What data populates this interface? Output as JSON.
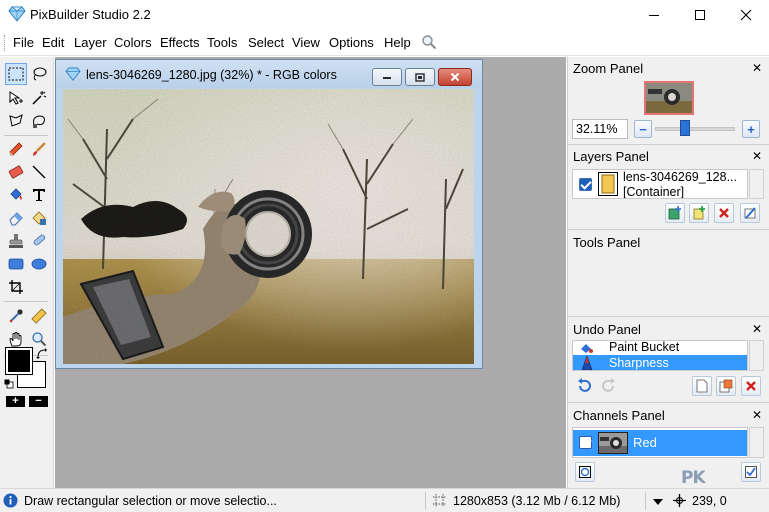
{
  "window": {
    "title": "PixBuilder Studio 2.2"
  },
  "menu": {
    "items": [
      "File",
      "Edit",
      "Layer",
      "Colors",
      "Effects",
      "Tools",
      "Select",
      "View",
      "Options",
      "Help"
    ]
  },
  "document": {
    "title": "lens-3046269_1280.jpg (32%) * - RGB colors"
  },
  "panels": {
    "zoom": {
      "title": "Zoom Panel",
      "value": "32.11%"
    },
    "layers": {
      "title": "Layers Panel",
      "item": {
        "name": "lens-3046269_128...",
        "type": "[Container]"
      }
    },
    "tools": {
      "title": "Tools Panel"
    },
    "undo": {
      "title": "Undo Panel",
      "items": [
        "Paint Bucket",
        "Sharpness"
      ],
      "selected": "Sharpness"
    },
    "channels": {
      "title": "Channels Panel",
      "item": "Red"
    }
  },
  "status": {
    "hint": "Draw rectangular selection or move selectio...",
    "dimensions": "1280x853  (3.12 Mb / 6.12 Mb)",
    "coords": "239, 0"
  },
  "watermark": "PK",
  "colors": {
    "selection": "#3399ff",
    "workspace": "#ababab",
    "doc_frame": "#bcd4ec",
    "close_red": "#c44332"
  }
}
